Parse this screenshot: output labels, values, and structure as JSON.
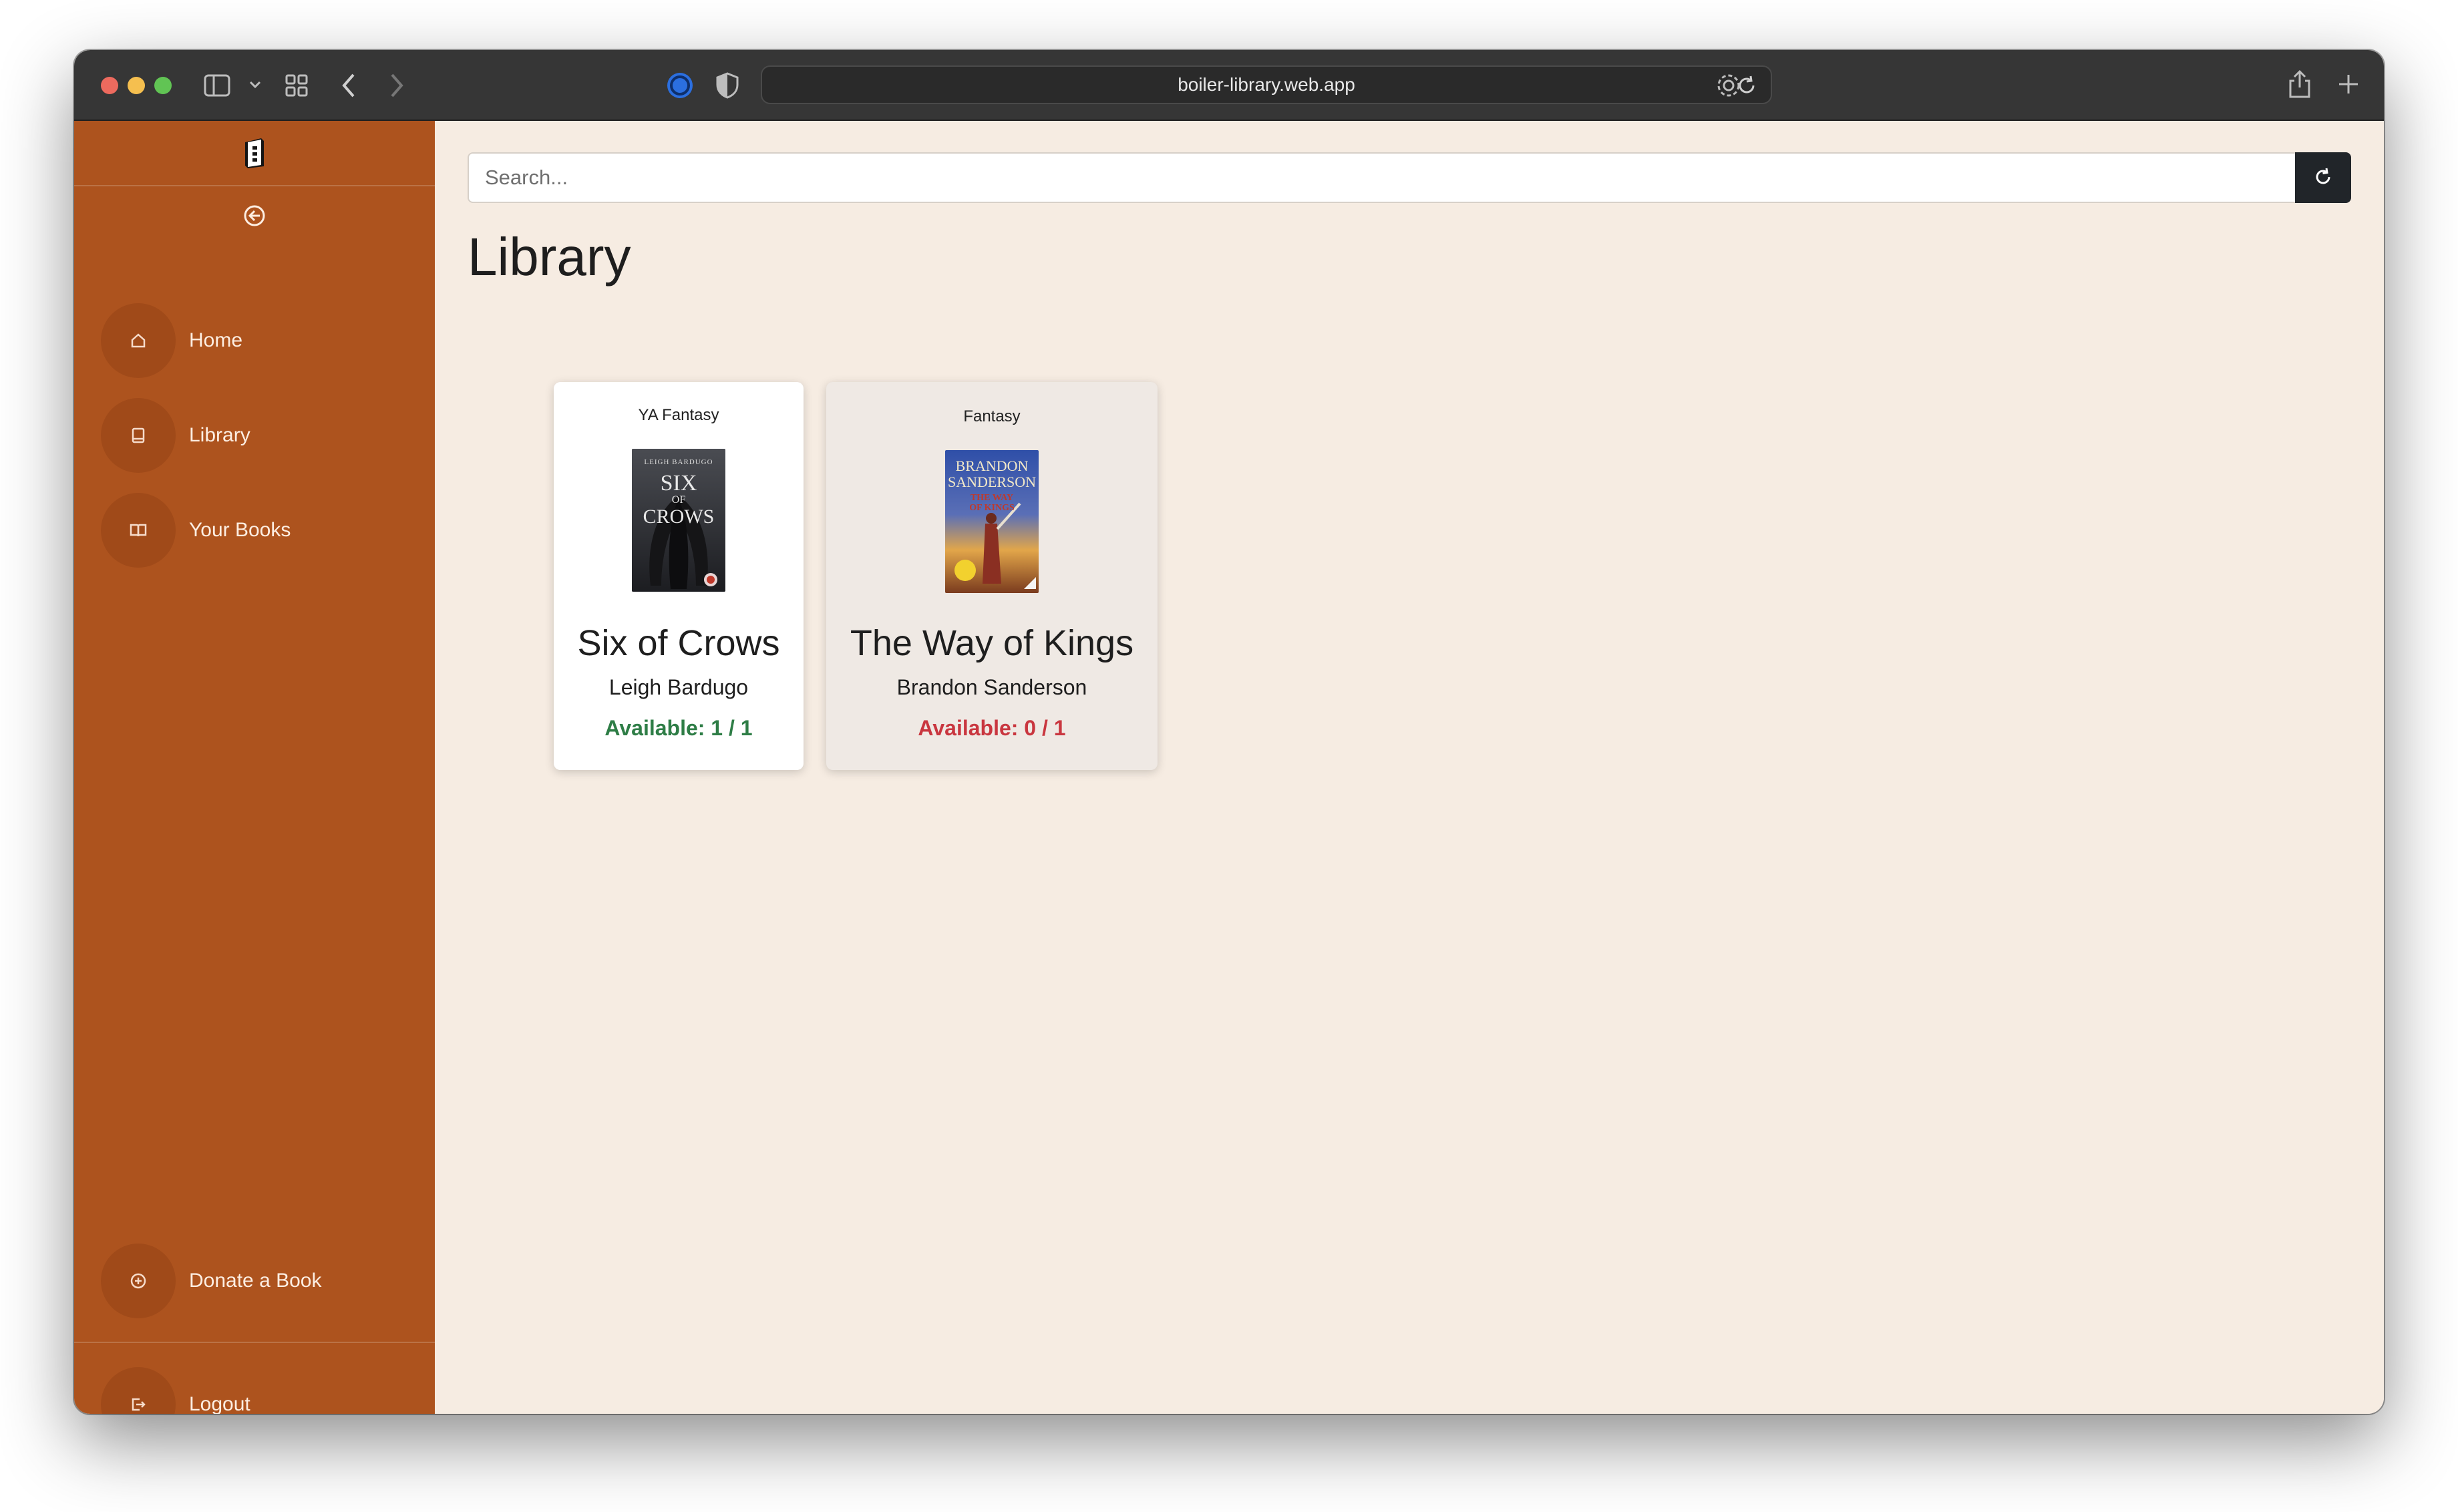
{
  "browser": {
    "url": "boiler-library.web.app"
  },
  "sidebar": {
    "nav_items": [
      {
        "label": "Home",
        "icon": "home-icon"
      },
      {
        "label": "Library",
        "icon": "book-icon"
      },
      {
        "label": "Your Books",
        "icon": "open-book-icon"
      }
    ],
    "donate_label": "Donate a Book",
    "logout_label": "Logout"
  },
  "search": {
    "placeholder": "Search..."
  },
  "page": {
    "title": "Library"
  },
  "books": [
    {
      "genre": "YA Fantasy",
      "title": "Six of Crows",
      "author": "Leigh Bardugo",
      "availability": "Available: 1 / 1",
      "status_color": "#2e7d46",
      "cover": {
        "top_text": "LEIGH BARDUGO",
        "title_lines": [
          "SIX",
          "OF",
          "CROWS"
        ]
      }
    },
    {
      "genre": "Fantasy",
      "title": "The Way of Kings",
      "author": "Brandon Sanderson",
      "availability": "Available: 0 / 1",
      "status_color": "#c9363f",
      "cover": {
        "top_text": "BRANDON SANDERSON",
        "title_lines": [
          "THE WAY",
          "OF KINGS"
        ]
      }
    }
  ],
  "colors": {
    "sidebar": "#ad531e",
    "background": "#f6ece2",
    "available": "#2e7d46",
    "unavailable": "#c9363f"
  }
}
